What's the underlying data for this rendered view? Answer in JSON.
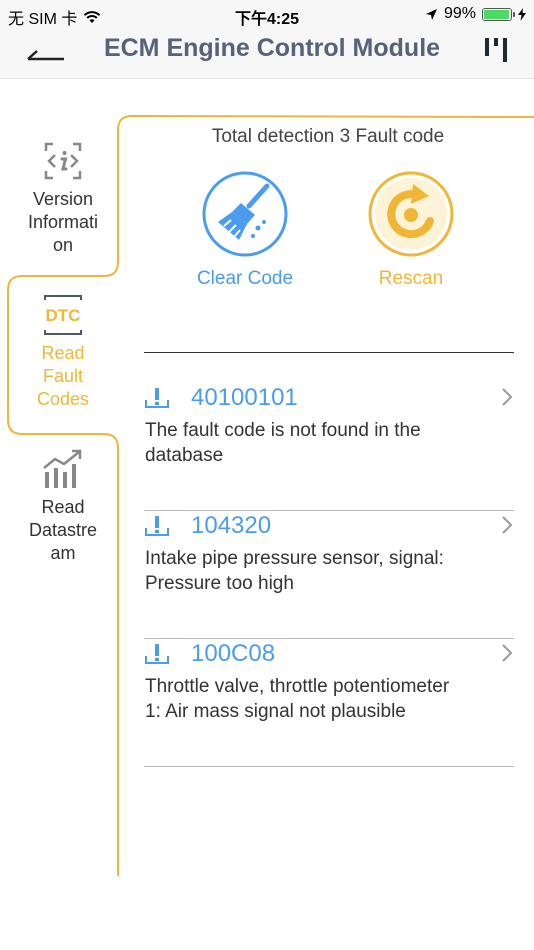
{
  "status_bar": {
    "carrier": "无 SIM 卡",
    "time": "下午4:25",
    "battery_percent": "99%",
    "battery_level": 0.99
  },
  "nav": {
    "title": "ECM Engine Control Module",
    "back_icon": "back-arrow-icon",
    "menu_icon": "menu-icon"
  },
  "sidebar": {
    "tabs": [
      {
        "label": "Version Informati on",
        "lines": [
          "Version",
          "Informati",
          "on"
        ],
        "icon": "info-icon",
        "active": false
      },
      {
        "label": "Read Fault Codes",
        "lines": [
          "Read",
          "Fault",
          "Codes"
        ],
        "icon_text": "DTC",
        "icon": "dtc-icon",
        "active": true
      },
      {
        "label": "Read Datastre am",
        "lines": [
          "Read",
          "Datastre",
          "am"
        ],
        "icon": "bar-chart-icon",
        "active": false
      }
    ]
  },
  "summary": "Total detection 3 Fault code",
  "actions": {
    "clear_label": "Clear Code",
    "rescan_label": "Rescan"
  },
  "faults": [
    {
      "code": "40100101",
      "lines": [
        "The fault code is not found in the",
        "database"
      ]
    },
    {
      "code": "104320",
      "lines": [
        "Intake pipe pressure sensor, signal:",
        "Pressure too high"
      ]
    },
    {
      "code": "100C08",
      "lines": [
        "Throttle valve, throttle potentiometer",
        "1: Air mass signal not plausible"
      ]
    }
  ],
  "colors": {
    "accent_orange": "#f2b637",
    "accent_blue": "#4a9cf0",
    "title_color": "#55627a"
  }
}
